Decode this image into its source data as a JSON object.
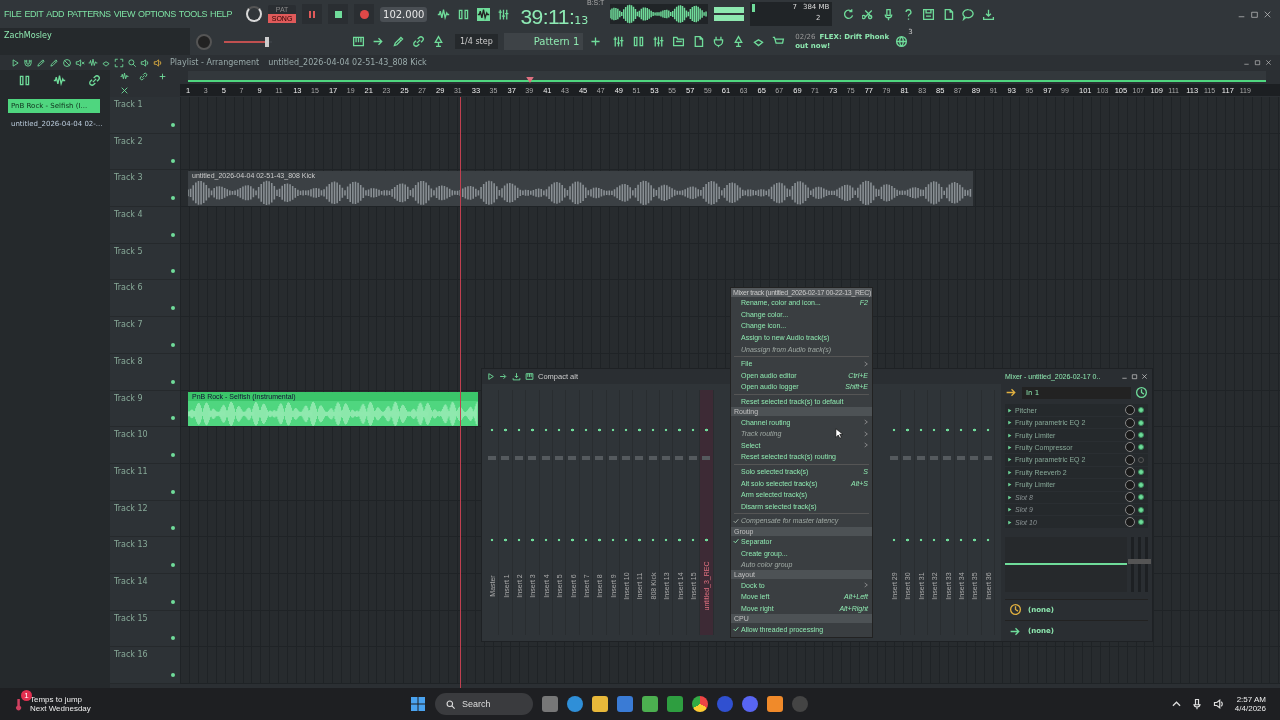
{
  "menu_bar": [
    "FILE",
    "EDIT",
    "ADD",
    "PATTERNS",
    "VIEW",
    "OPTIONS",
    "TOOLS",
    "HELP"
  ],
  "user": "ZachMosley",
  "mode_buttons": [
    {
      "label": "PAT",
      "selected": false
    },
    {
      "label": "SONG",
      "selected": true
    }
  ],
  "tempo": "102.000",
  "time": {
    "main": "39:11:",
    "small": "13",
    "unit": "B:S:T"
  },
  "cpu": {
    "voices": "7",
    "memory": "384 MB",
    "polyphony": "2"
  },
  "snap": "1/4 step",
  "pattern": "Pattern 1",
  "news": {
    "date": "02/26",
    "title": "FLEX: Drift Phonk",
    "line2": "out now!",
    "count": "3"
  },
  "playlist": {
    "title": "Playlist - Arrangement",
    "breadcrumb": "untitled_2026-04-04 02-51-43_808 Kick",
    "ruler": [
      "1",
      "3",
      "5",
      "7",
      "9",
      "11",
      "13",
      "15",
      "17",
      "19",
      "21",
      "23",
      "25",
      "27",
      "29",
      "31",
      "33",
      "35",
      "37",
      "39",
      "41",
      "43",
      "45",
      "47",
      "49",
      "51",
      "53",
      "55",
      "57",
      "59",
      "61",
      "63",
      "65",
      "67",
      "69",
      "71",
      "73",
      "75",
      "77",
      "79",
      "81",
      "83",
      "85",
      "87",
      "89",
      "91",
      "93",
      "95",
      "97",
      "99",
      "101",
      "103",
      "105",
      "107",
      "109",
      "111",
      "113",
      "115",
      "117",
      "119"
    ],
    "tracks": [
      {
        "name": "Track 1"
      },
      {
        "name": "Track 2"
      },
      {
        "name": "Track 3",
        "clips": [
          {
            "label": "untitled_2026-04-04 02-51-43_808 Kick",
            "kind": "audio",
            "color": "#3b4044"
          }
        ]
      },
      {
        "name": "Track 4"
      },
      {
        "name": "Track 5"
      },
      {
        "name": "Track 6"
      },
      {
        "name": "Track 7"
      },
      {
        "name": "Track 8"
      },
      {
        "name": "Track 9",
        "clips": [
          {
            "label": "PnB Rock - Selfish (Instrumental)",
            "kind": "sample",
            "color": "#4fd67f"
          }
        ]
      },
      {
        "name": "Track 10"
      },
      {
        "name": "Track 11"
      },
      {
        "name": "Track 12"
      },
      {
        "name": "Track 13"
      },
      {
        "name": "Track 14"
      },
      {
        "name": "Track 15"
      },
      {
        "name": "Track 16"
      }
    ]
  },
  "browser": [
    {
      "label": "PnB Rock - Selfish (I...",
      "selected": true
    },
    {
      "label": "untitled_2026-04-04 02-...",
      "selected": false
    }
  ],
  "mixer": {
    "preset": "Compact alt",
    "title": "Mixer - untitled_2026-02-17 0..",
    "strips": [
      {
        "label": "Master",
        "selected": false
      },
      {
        "label": "Insert 1",
        "selected": false
      },
      {
        "label": "Insert 2",
        "selected": false
      },
      {
        "label": "Insert 3",
        "selected": false
      },
      {
        "label": "Insert 4",
        "selected": false
      },
      {
        "label": "Insert 5",
        "selected": false
      },
      {
        "label": "Insert 6",
        "selected": false
      },
      {
        "label": "Insert 7",
        "selected": false
      },
      {
        "label": "Insert 8",
        "selected": false
      },
      {
        "label": "Insert 9",
        "selected": false
      },
      {
        "label": "Insert 10",
        "selected": false
      },
      {
        "label": "Insert 11",
        "selected": false
      },
      {
        "label": "808 Kick",
        "selected": false
      },
      {
        "label": "Insert 13",
        "selected": false
      },
      {
        "label": "Insert 14",
        "selected": false
      },
      {
        "label": "Insert 15",
        "selected": false
      },
      {
        "label": "untitled_3_REC",
        "selected": true
      }
    ],
    "strips_right": [
      {
        "label": "Insert 29",
        "selected": false
      },
      {
        "label": "Insert 30",
        "selected": false
      },
      {
        "label": "Insert 31",
        "selected": false
      },
      {
        "label": "Insert 32",
        "selected": false
      },
      {
        "label": "Insert 33",
        "selected": false
      },
      {
        "label": "Insert 34",
        "selected": false
      },
      {
        "label": "Insert 35",
        "selected": false
      },
      {
        "label": "Insert 36",
        "selected": false
      }
    ],
    "input": "In 1",
    "slots": [
      {
        "name": "Pitcher",
        "kind": "plugin",
        "on": true
      },
      {
        "name": "Fruity parametric EQ 2",
        "kind": "plugin",
        "on": true
      },
      {
        "name": "Fruity Limiter",
        "kind": "plugin",
        "on": true
      },
      {
        "name": "Fruity Compressor",
        "kind": "plugin",
        "on": true
      },
      {
        "name": "Fruity parametric EQ 2",
        "kind": "plugin",
        "on": false
      },
      {
        "name": "Fruity Reeverb 2",
        "kind": "plugin",
        "on": true
      },
      {
        "name": "Fruity Limiter",
        "kind": "plugin",
        "on": true
      },
      {
        "name": "Slot 8",
        "kind": "empty",
        "on": true
      },
      {
        "name": "Slot 9",
        "kind": "empty",
        "on": true
      },
      {
        "name": "Slot 10",
        "kind": "empty",
        "on": true
      }
    ],
    "send": "(none)",
    "output": "(none)"
  },
  "context_menu": {
    "title": "Mixer track (untitled_2026-02-17 00-22-13_REC)",
    "items": [
      {
        "kind": "item",
        "label": "Rename, color and icon...",
        "shortcut": "F2",
        "disabled": false,
        "submenu": false,
        "checked": false
      },
      {
        "kind": "item",
        "label": "Change color...",
        "disabled": false,
        "submenu": false,
        "checked": false
      },
      {
        "kind": "item",
        "label": "Change icon...",
        "disabled": false,
        "submenu": false,
        "checked": false
      },
      {
        "kind": "item",
        "label": "Assign to new Audio track(s)",
        "disabled": false,
        "submenu": false,
        "checked": false
      },
      {
        "kind": "item",
        "label": "Unassign from Audio track(s)",
        "disabled": true,
        "submenu": false,
        "checked": false
      },
      {
        "kind": "separator"
      },
      {
        "kind": "item",
        "label": "File",
        "disabled": false,
        "submenu": true,
        "checked": false
      },
      {
        "kind": "item",
        "label": "Open audio editor",
        "shortcut": "Ctrl+E",
        "disabled": false,
        "submenu": false,
        "checked": false
      },
      {
        "kind": "item",
        "label": "Open audio logger",
        "shortcut": "Shift+E",
        "disabled": false,
        "submenu": false,
        "checked": false
      },
      {
        "kind": "separator"
      },
      {
        "kind": "item",
        "label": "Reset selected track(s) to default",
        "disabled": false,
        "submenu": false,
        "checked": false
      },
      {
        "kind": "section",
        "label": "Routing"
      },
      {
        "kind": "item",
        "label": "Channel routing",
        "disabled": false,
        "submenu": true,
        "checked": false
      },
      {
        "kind": "item",
        "label": "Track routing",
        "disabled": true,
        "submenu": true,
        "checked": false
      },
      {
        "kind": "item",
        "label": "Select",
        "disabled": false,
        "submenu": true,
        "checked": false
      },
      {
        "kind": "item",
        "label": "Reset selected track(s) routing",
        "disabled": false,
        "submenu": false,
        "checked": false
      },
      {
        "kind": "separator"
      },
      {
        "kind": "item",
        "label": "Solo selected track(s)",
        "shortcut": "S",
        "disabled": false,
        "submenu": false,
        "checked": false
      },
      {
        "kind": "item",
        "label": "Alt solo selected track(s)",
        "shortcut": "Alt+S",
        "disabled": false,
        "submenu": false,
        "checked": false
      },
      {
        "kind": "item",
        "label": "Arm selected track(s)",
        "disabled": false,
        "submenu": false,
        "checked": false
      },
      {
        "kind": "item",
        "label": "Disarm selected track(s)",
        "disabled": false,
        "submenu": false,
        "checked": false
      },
      {
        "kind": "separator"
      },
      {
        "kind": "item",
        "label": "Compensate for master latency",
        "disabled": true,
        "submenu": false,
        "checked": true
      },
      {
        "kind": "section",
        "label": "Group"
      },
      {
        "kind": "item",
        "label": "Separator",
        "disabled": false,
        "submenu": false,
        "checked": true
      },
      {
        "kind": "item",
        "label": "Create group...",
        "disabled": false,
        "submenu": false,
        "checked": false
      },
      {
        "kind": "item",
        "label": "Auto color group",
        "disabled": true,
        "submenu": false,
        "checked": false
      },
      {
        "kind": "section",
        "label": "Layout"
      },
      {
        "kind": "item",
        "label": "Dock to",
        "disabled": false,
        "submenu": true,
        "checked": false
      },
      {
        "kind": "item",
        "label": "Move left",
        "shortcut": "Alt+Left",
        "disabled": false,
        "submenu": false,
        "checked": false
      },
      {
        "kind": "item",
        "label": "Move right",
        "shortcut": "Alt+Right",
        "disabled": false,
        "submenu": false,
        "checked": false
      },
      {
        "kind": "section",
        "label": "CPU"
      },
      {
        "kind": "item",
        "label": "Allow threaded processing",
        "disabled": false,
        "submenu": false,
        "checked": true
      }
    ]
  },
  "taskbar": {
    "weather": {
      "title": "Temps to jump",
      "subtitle": "Next Wednesday",
      "badge": "1"
    },
    "search": "Search",
    "time": "2:57 AM",
    "date": "4/4/2026"
  }
}
